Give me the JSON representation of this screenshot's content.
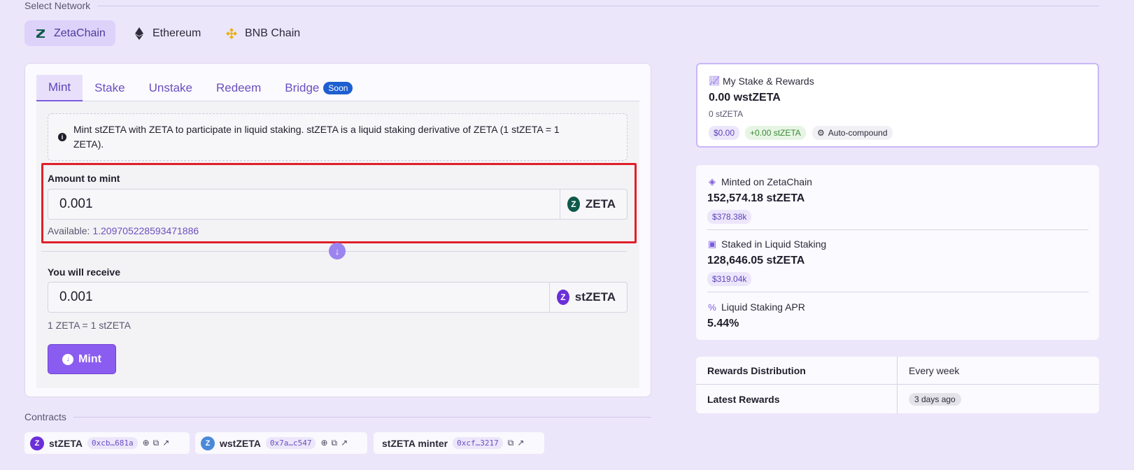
{
  "network": {
    "heading": "Select Network",
    "options": [
      {
        "label": "ZetaChain",
        "active": true
      },
      {
        "label": "Ethereum",
        "active": false
      },
      {
        "label": "BNB Chain",
        "active": false
      }
    ]
  },
  "tabs": {
    "mint": "Mint",
    "stake": "Stake",
    "unstake": "Unstake",
    "redeem": "Redeem",
    "bridge": "Bridge",
    "bridge_badge": "Soon"
  },
  "info": {
    "text": "Mint stZETA with ZETA to participate in liquid staking. stZETA is a liquid staking derivative of ZETA (1 stZETA = 1 ZETA)."
  },
  "mint_form": {
    "amount_label": "Amount to mint",
    "amount_value": "0.001",
    "amount_token": "ZETA",
    "available_label": "Available:",
    "available_value": "1.209705228593471886",
    "receive_label": "You will receive",
    "receive_value": "0.001",
    "receive_token": "stZETA",
    "rate": "1 ZETA = 1 stZETA",
    "submit_label": "Mint"
  },
  "contracts": {
    "heading": "Contracts",
    "items": [
      {
        "name": "stZETA",
        "address": "0xcb…681a"
      },
      {
        "name": "wstZETA",
        "address": "0x7a…c547"
      },
      {
        "name": "stZETA minter",
        "address": "0xcf…3217"
      }
    ]
  },
  "my_stake": {
    "title": "My Stake & Rewards",
    "value": "0.00 wstZETA",
    "sub": "0 stZETA",
    "usd": "$0.00",
    "gain": "+0.00 stZETA",
    "autocompound": "Auto-compound"
  },
  "stats": {
    "minted_title": "Minted on ZetaChain",
    "minted_value": "152,574.18 stZETA",
    "minted_usd": "$378.38k",
    "staked_title": "Staked in Liquid Staking",
    "staked_value": "128,646.05 stZETA",
    "staked_usd": "$319.04k",
    "apr_title": "Liquid Staking APR",
    "apr_value": "5.44%"
  },
  "distribution": {
    "rewards_label": "Rewards Distribution",
    "rewards_value": "Every week",
    "latest_label": "Latest Rewards",
    "latest_value": "3 days ago"
  },
  "colors": {
    "accent": "#7c5ce0",
    "background": "#ece6fb",
    "highlight": "#e0202a",
    "mint_button": "#8b5cf0"
  }
}
